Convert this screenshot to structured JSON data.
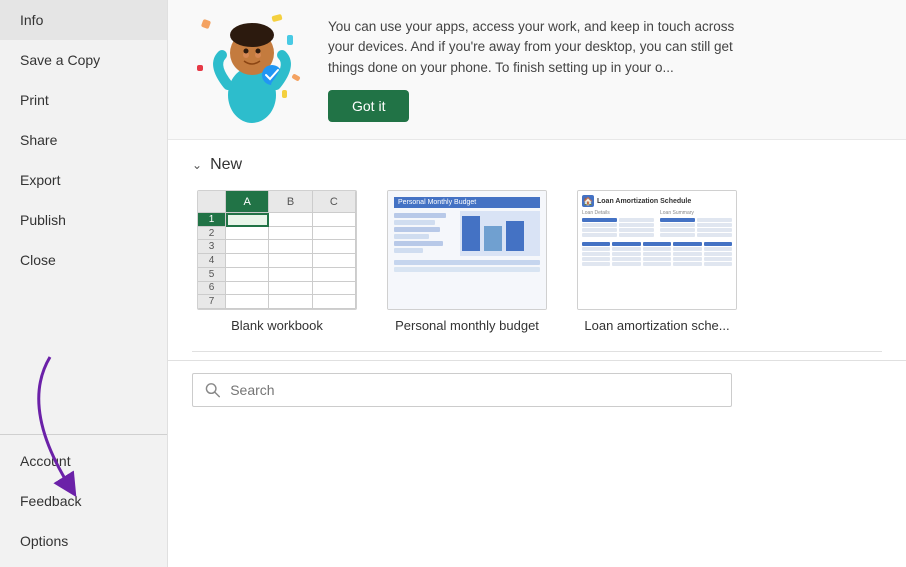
{
  "sidebar": {
    "top_items": [
      {
        "id": "info",
        "label": "Info"
      },
      {
        "id": "save-copy",
        "label": "Save a Copy"
      },
      {
        "id": "print",
        "label": "Print"
      },
      {
        "id": "share",
        "label": "Share"
      },
      {
        "id": "export",
        "label": "Export"
      },
      {
        "id": "publish",
        "label": "Publish"
      },
      {
        "id": "close",
        "label": "Close"
      }
    ],
    "bottom_items": [
      {
        "id": "account",
        "label": "Account"
      },
      {
        "id": "feedback",
        "label": "Feedback"
      },
      {
        "id": "options",
        "label": "Options"
      }
    ]
  },
  "banner": {
    "text": "You can use your apps, access your work, and keep in touch across your devices. And if you're away from your desktop, you can still get things done on your phone. To finish setting up in your o...",
    "button_label": "Got it"
  },
  "new_section": {
    "header": "New",
    "templates": [
      {
        "id": "blank-workbook",
        "label": "Blank workbook"
      },
      {
        "id": "personal-monthly-budget",
        "label": "Personal monthly budget"
      },
      {
        "id": "loan-amortization",
        "label": "Loan amortization sche..."
      }
    ]
  },
  "search": {
    "placeholder": "Search",
    "value": ""
  },
  "grid": {
    "col_headers": [
      "A",
      "B",
      "C"
    ],
    "row_numbers": [
      "1",
      "2",
      "3",
      "4",
      "5",
      "6",
      "7"
    ]
  },
  "colors": {
    "accent_green": "#217346",
    "sidebar_bg": "#f2f2f2",
    "banner_bg": "#f9f9f9"
  }
}
